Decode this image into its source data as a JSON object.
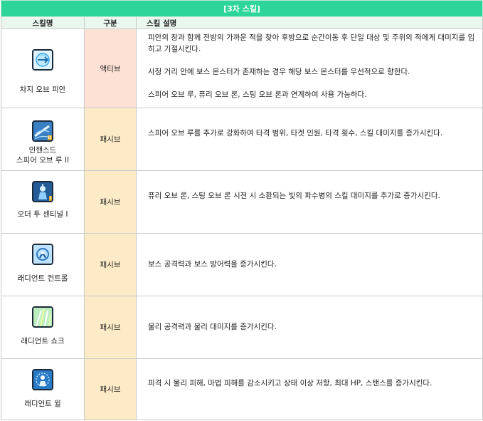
{
  "title": "[3차 스킬]",
  "headers": {
    "name": "스킬명",
    "type": "구분",
    "desc": "스킬 설명"
  },
  "skills": [
    {
      "icon": "piercing-orb-icon",
      "name_lines": [
        "차지 오브 피안"
      ],
      "type": "액티브",
      "desc": [
        "피안의 창과 함께 전방의 가까운 적을 찾아 후방으로 순간이동 후 단일 대상 및 주위의 적에게 대미지를 입히고 기절시킨다.",
        "사정 거리 안에 보스 몬스터가 존재하는 경우 해당 보스 몬스터를 우선적으로 향한다.",
        "스피어 오브 루, 퓨리 오브 론, 스팅 오브 론과 연계하여 사용 가능하다."
      ]
    },
    {
      "icon": "spear-enhance-icon",
      "name_lines": [
        "인핸스드",
        "스피어 오브 루 II"
      ],
      "type": "패시브",
      "desc": [
        "스피어 오브 루를 추가로 강화하여 타격 범위, 타겟 인원, 타격 횟수, 스킬 대미지를 증가시킨다."
      ]
    },
    {
      "icon": "sentinel-icon",
      "name_lines": [
        "오더 투 센티널 I"
      ],
      "type": "패시브",
      "desc": [
        "퓨리 오브 론, 스팅 오브 론 시전 시 소환되는 빛의 파수병의 스킬 대미지를 추가로 증가시킨다."
      ]
    },
    {
      "icon": "radiant-control-icon",
      "name_lines": [
        "래디언트 컨트롤"
      ],
      "type": "패시브",
      "desc": [
        "보스 공격력과 보스 방어력을 증가시킨다."
      ]
    },
    {
      "icon": "radiant-shock-icon",
      "name_lines": [
        "래디언트 쇼크"
      ],
      "type": "패시브",
      "desc": [
        "물리 공격력과 물리 대미지를 증가시킨다."
      ]
    },
    {
      "icon": "radiant-will-icon",
      "name_lines": [
        "래디언트 윌"
      ],
      "type": "패시브",
      "desc": [
        "피격 시 물리 피해, 마법 피해를 감소시키고 상태 이상 저항, 최대 HP, 스탠스를 증가시킨다."
      ]
    }
  ]
}
